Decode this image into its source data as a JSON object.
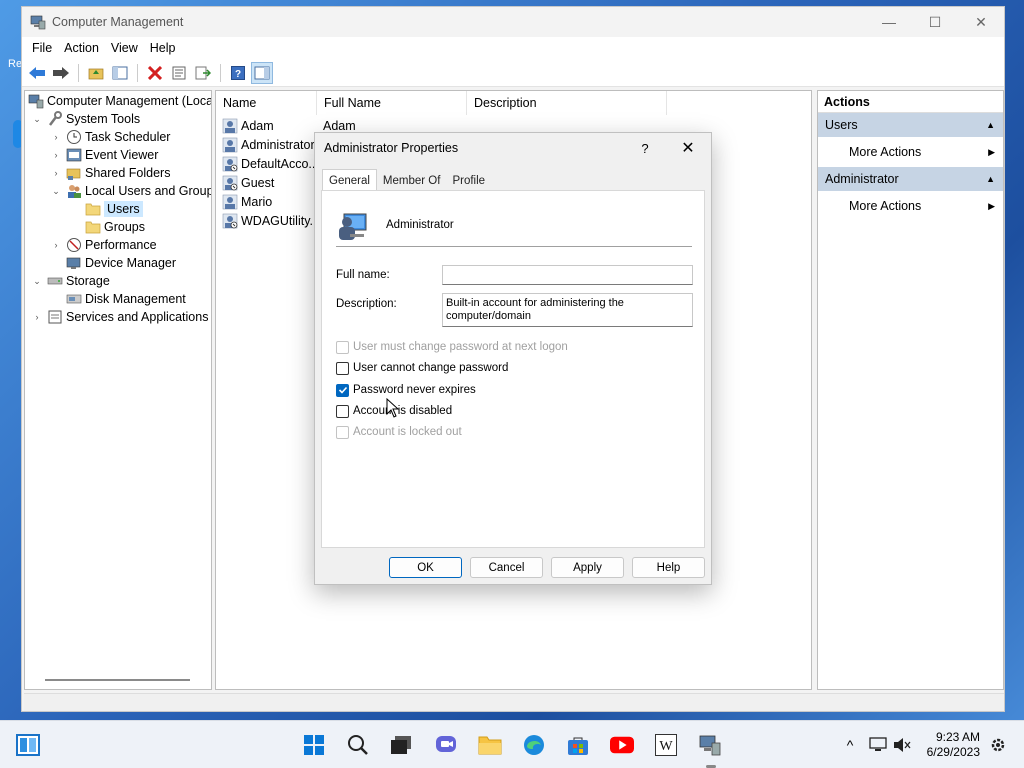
{
  "desktop": {
    "icon_label": "Re"
  },
  "window": {
    "title": "Computer Management",
    "controls": {
      "minimize": "—",
      "maximize": "☐",
      "close": "✕"
    }
  },
  "menu": [
    "File",
    "Action",
    "View",
    "Help"
  ],
  "tree": {
    "root": "Computer Management (Local",
    "items": {
      "system_tools": "System Tools",
      "task_scheduler": "Task Scheduler",
      "event_viewer": "Event Viewer",
      "shared_folders": "Shared Folders",
      "local_users_groups": "Local Users and Groups",
      "users": "Users",
      "groups": "Groups",
      "performance": "Performance",
      "device_manager": "Device Manager",
      "storage": "Storage",
      "disk_management": "Disk Management",
      "services_apps": "Services and Applications"
    }
  },
  "list": {
    "columns": [
      "Name",
      "Full Name",
      "Description"
    ],
    "rows": [
      {
        "name": "Adam",
        "full_name": "Adam"
      },
      {
        "name": "Administrator",
        "full_name": ""
      },
      {
        "name": "DefaultAcco...",
        "full_name": ""
      },
      {
        "name": "Guest",
        "full_name": ""
      },
      {
        "name": "Mario",
        "full_name": ""
      },
      {
        "name": "WDAGUtility...",
        "full_name": ""
      }
    ]
  },
  "actions": {
    "header": "Actions",
    "sections": [
      {
        "title": "Users",
        "item": "More Actions"
      },
      {
        "title": "Administrator",
        "item": "More Actions"
      }
    ]
  },
  "dialog": {
    "title": "Administrator Properties",
    "help": "?",
    "close": "✕",
    "tabs": [
      "General",
      "Member Of",
      "Profile"
    ],
    "user_name": "Administrator",
    "full_name_label": "Full name:",
    "full_name_value": "",
    "description_label": "Description:",
    "description_value": "Built-in account for administering the computer/domain",
    "checkboxes": [
      {
        "label": "User must change password at next logon",
        "checked": false,
        "disabled": true
      },
      {
        "label": "User cannot change password",
        "checked": false,
        "disabled": false
      },
      {
        "label": "Password never expires",
        "checked": true,
        "disabled": false
      },
      {
        "label": "Account is disabled",
        "checked": false,
        "disabled": false
      },
      {
        "label": "Account is locked out",
        "checked": false,
        "disabled": true
      }
    ],
    "buttons": {
      "ok": "OK",
      "cancel": "Cancel",
      "apply": "Apply",
      "help": "Help"
    }
  },
  "taskbar": {
    "time": "9:23 AM",
    "date": "6/29/2023",
    "chevron": "^"
  },
  "colors": {
    "accent": "#0067c0",
    "selection": "#cce8ff",
    "section_bg": "#c6d4e4"
  }
}
